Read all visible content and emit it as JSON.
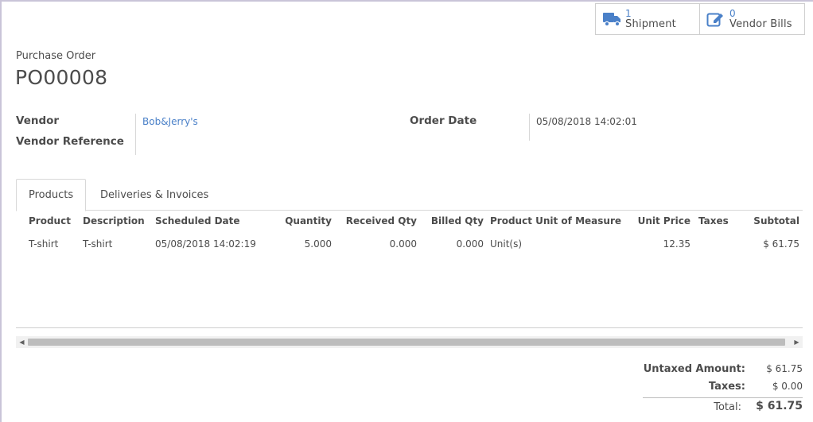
{
  "smart_buttons": [
    {
      "count": "1",
      "label": "Shipment",
      "icon": "truck-icon"
    },
    {
      "count": "0",
      "label": "Vendor Bills",
      "icon": "edit-document-icon"
    }
  ],
  "header": {
    "doc_type_label": "Purchase Order",
    "doc_name": "PO00008"
  },
  "fields": {
    "vendor_label": "Vendor",
    "vendor_value": "Bob&Jerry's",
    "vendor_reference_label": "Vendor Reference",
    "order_date_label": "Order Date",
    "order_date_value": "05/08/2018 14:02:01"
  },
  "tabs": [
    {
      "label": "Products",
      "active": true
    },
    {
      "label": "Deliveries & Invoices",
      "active": false
    }
  ],
  "order_lines": {
    "columns": [
      "Product",
      "Description",
      "Scheduled Date",
      "Quantity",
      "Received Qty",
      "Billed Qty",
      "Product Unit of Measure",
      "Unit Price",
      "Taxes",
      "Subtotal"
    ],
    "rows": [
      [
        "T-shirt",
        "T-shirt",
        "05/08/2018 14:02:19",
        "5.000",
        "0.000",
        "0.000",
        "Unit(s)",
        "12.35",
        "",
        "$ 61.75"
      ]
    ]
  },
  "totals": {
    "untaxed_label": "Untaxed Amount:",
    "untaxed_value": "$ 61.75",
    "taxes_label": "Taxes:",
    "taxes_value": "$ 0.00",
    "total_label": "Total:",
    "total_value": "$ 61.75"
  },
  "colors": {
    "link": "#4a80c8",
    "text": "#4c4c4c",
    "border": "#d8d8d8"
  }
}
